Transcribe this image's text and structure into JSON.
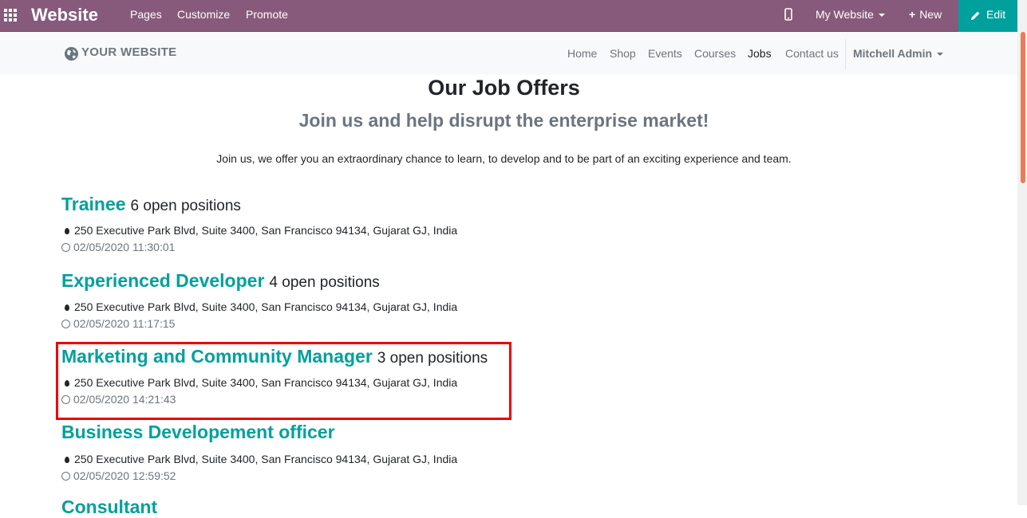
{
  "admin_bar": {
    "brand": "Website",
    "menu": [
      "Pages",
      "Customize",
      "Promote"
    ],
    "website_selector": "My Website",
    "new_label": "New",
    "edit_label": "Edit",
    "accent_color": "#875a7b",
    "edit_color": "#00a09d"
  },
  "site_nav": {
    "logo": "YOUR WEBSITE",
    "links": [
      "Home",
      "Shop",
      "Events",
      "Courses",
      "Jobs",
      "Contact us"
    ],
    "active": "Jobs",
    "user": "Mitchell Admin"
  },
  "page": {
    "heading": "Our Job Offers",
    "subheading": "Join us and help disrupt the enterprise market!",
    "intro": "Join us, we offer you an extraordinary chance to learn, to develop and to be part of an exciting experience and team."
  },
  "jobs": [
    {
      "title": "Trainee",
      "count": "6 open positions",
      "address": "250 Executive Park Blvd, Suite 3400, San Francisco 94134, Gujarat GJ, India",
      "date": "02/05/2020 11:30:01"
    },
    {
      "title": "Experienced Developer",
      "count": "4 open positions",
      "address": "250 Executive Park Blvd, Suite 3400, San Francisco 94134, Gujarat GJ, India",
      "date": "02/05/2020 11:17:15"
    },
    {
      "title": "Marketing and Community Manager",
      "count": "3 open positions",
      "address": "250 Executive Park Blvd, Suite 3400, San Francisco 94134, Gujarat GJ, India",
      "date": "02/05/2020 14:21:43"
    },
    {
      "title": "Business Developement officer",
      "count": "",
      "address": "250 Executive Park Blvd, Suite 3400, San Francisco 94134, Gujarat GJ, India",
      "date": "02/05/2020 12:59:52"
    },
    {
      "title": "Consultant",
      "count": "",
      "address": "",
      "date": ""
    }
  ]
}
